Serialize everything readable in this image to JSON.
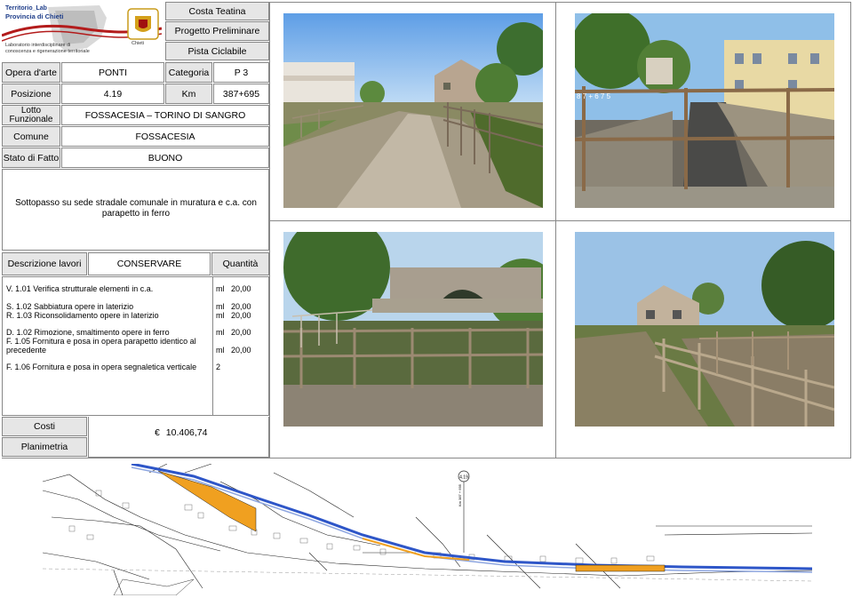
{
  "logo": {
    "line1": "Territorio_Lab",
    "line2": "Provincia di Chieti",
    "line3": "Laboratorio interdisciplinare di",
    "line4": "conoscenza e rigenerazione territoriale",
    "badge": "Chieti"
  },
  "header": {
    "title1": "Costa Teatina",
    "title2": "Progetto Preliminare",
    "title3": "Pista Ciclabile"
  },
  "fields": {
    "opera_label": "Opera d'arte",
    "opera_value": "PONTI",
    "categoria_label": "Categoria",
    "categoria_value": "P 3",
    "posizione_label": "Posizione",
    "posizione_value": "4.19",
    "km_label": "Km",
    "km_value": "387+695",
    "lotto_label": "Lotto Funzionale",
    "lotto_value": "FOSSACESIA – TORINO DI SANGRO",
    "comune_label": "Comune",
    "comune_value": "FOSSACESIA",
    "stato_label": "Stato di Fatto",
    "stato_value": "BUONO"
  },
  "description": "Sottopasso su sede stradale comunale in muratura e c.a. con parapetto in ferro",
  "works": {
    "desc_label": "Descrizione lavori",
    "action_label": "CONSERVARE",
    "qty_label": "Quantità",
    "items": [
      {
        "text": "V. 1.01  Verifica strutturale elementi in c.a.",
        "unit": "ml",
        "qty": "20,00"
      },
      {
        "text": "S. 1.02  Sabbiatura opere in laterizio",
        "unit": "ml",
        "qty": "20,00"
      },
      {
        "text": "R. 1.03  Riconsolidamento opere in laterizio",
        "unit": "ml",
        "qty": "20,00"
      },
      {
        "text": "D. 1.02  Rimozione, smaltimento opere in ferro",
        "unit": "ml",
        "qty": "20,00"
      },
      {
        "text": "F. 1.05  Fornitura e posa in opera parapetto identico al",
        "unit": "ml",
        "qty": "20,00"
      },
      {
        "text": "precedente",
        "unit": "",
        "qty": ""
      },
      {
        "text": "F. 1.06  Fornitura e posa in opera segnaletica verticale",
        "unit": "",
        "qty": "2"
      }
    ]
  },
  "costi": {
    "label": "Costi",
    "currency": "€",
    "value": "10.406,74"
  },
  "planimetria": {
    "label": "Planimetria",
    "marker": "4.19",
    "marker_km": "Km 387 + 695"
  },
  "photo_labels": {
    "railing_km": "8 7 + 6 7 5"
  },
  "colors": {
    "header_bg": "#e6e6e6",
    "border": "#888888",
    "track_blue": "#2e56c8",
    "path_orange": "#f0a020"
  }
}
